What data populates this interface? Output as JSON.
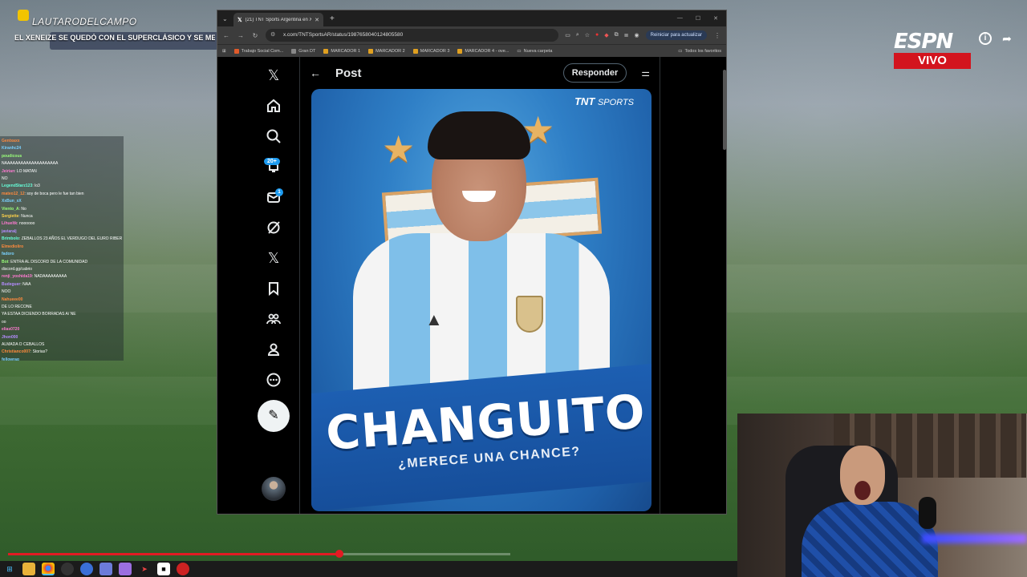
{
  "stream": {
    "streamer_name": "LAUTARODELCAMPO",
    "headline": "EL XENEIZE SE QUEDÓ CON EL SUPERCLÁSICO Y SE ME"
  },
  "broadcast": {
    "network": "ESPN",
    "live_label": "VIVO",
    "accent_color": "#d3141e"
  },
  "chat": {
    "messages": [
      {
        "user": "Gentxaxx",
        "text": ""
      },
      {
        "user": "Kiranhc24",
        "text": ""
      },
      {
        "user": "poudicous",
        "text": ""
      },
      {
        "user": "",
        "text": "NAAAAAAAAAAAAAAAAAAAA"
      },
      {
        "user": "Jeirian",
        "text": "LO MATAN"
      },
      {
        "user": "",
        "text": "NO"
      },
      {
        "user": "LegendStarz123",
        "text": "lo3"
      },
      {
        "user": "mateo12_12",
        "text": "soy de boca pero le fue tan bien"
      },
      {
        "user": "XxBun_xX",
        "text": ""
      },
      {
        "user": "Viento_A",
        "text": "No"
      },
      {
        "user": "Sergiette",
        "text": "Nunca"
      },
      {
        "user": "Lihueltk",
        "text": "noooooo"
      },
      {
        "user": "javiaralj",
        "text": ""
      },
      {
        "user": "Brimbolo",
        "text": "ZEBALLOS 23 AÑOS EL VERDUGO DEL EURO RIBER"
      },
      {
        "user": "Elmedioliro",
        "text": ""
      },
      {
        "user": "fadoro",
        "text": ""
      },
      {
        "user": "Bot",
        "text": "ENTRA AL DISCORD DE LA COMUNIDAD"
      },
      {
        "user": "",
        "text": "discord.gg/cabrio"
      },
      {
        "user": "renji_yoshida19",
        "text": "NADAAAAAAAAA"
      },
      {
        "user": "Budeguer",
        "text": "NAA"
      },
      {
        "user": "",
        "text": "NOO"
      },
      {
        "user": "Nahueee00",
        "text": ""
      },
      {
        "user": "",
        "text": "DE LO RECONE"
      },
      {
        "user": "",
        "text": "YA ESTAA DICIENDO BORRADAS A/ NE"
      },
      {
        "user": "",
        "text": "oo"
      },
      {
        "user": "elias0720",
        "text": ""
      },
      {
        "user": "Jhon000",
        "text": ""
      },
      {
        "user": "",
        "text": "ALMADA O CEBALLOS"
      },
      {
        "user": "Christianco007",
        "text": "Storias?"
      },
      {
        "user": "fellowrag",
        "text": ""
      }
    ]
  },
  "browser": {
    "tab_title": "(21) TNT Sports Argentina en X",
    "url": "x.com/TNTSportsAR/status/1987658040124805580",
    "update_label": "Reiniciar para actualizar",
    "bookmarks": [
      "Trabajo Social Com...",
      "Gran DT",
      "MARCADOR 1",
      "MARCADOR 2",
      "MARCADOR 3",
      "MARCADOR 4 - ove...",
      "Nueva carpeta"
    ],
    "all_bookmarks": "Todos los favoritos"
  },
  "x": {
    "notif_badge": "20+",
    "message_badge": "1",
    "post_title": "Post",
    "reply_label": "Responder",
    "media": {
      "brand": "TNT",
      "brand_suffix": "SPORTS",
      "title": "CHANGUITO",
      "subtitle": "¿MERECE UNA CHANCE?"
    }
  },
  "video": {
    "progress_fraction": 0.66
  }
}
